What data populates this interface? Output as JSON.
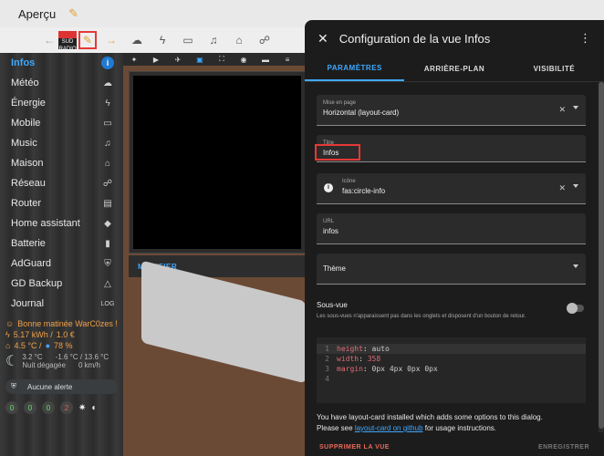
{
  "header": {
    "title": "Aperçu"
  },
  "toolbar": {
    "sud_badge": "SUD RADIO"
  },
  "sidebar": {
    "items": [
      {
        "label": "Infos",
        "icon": "info-icon"
      },
      {
        "label": "Météo",
        "icon": "weather-icon"
      },
      {
        "label": "Énergie",
        "icon": "bolt-icon"
      },
      {
        "label": "Mobile",
        "icon": "devices-icon"
      },
      {
        "label": "Music",
        "icon": "music-icon"
      },
      {
        "label": "Maison",
        "icon": "home-icon"
      },
      {
        "label": "Réseau",
        "icon": "network-icon"
      },
      {
        "label": "Router",
        "icon": "router-icon"
      },
      {
        "label": "Home assistant",
        "icon": "ha-icon"
      },
      {
        "label": "Batterie",
        "icon": "battery-icon"
      },
      {
        "label": "AdGuard",
        "icon": "shield-icon"
      },
      {
        "label": "GD Backup",
        "icon": "drive-icon"
      },
      {
        "label": "Journal",
        "icon": "log-icon"
      }
    ],
    "status": {
      "greeting": "Bonne matinée WarC0zes !",
      "energy": "5.17 kWh /",
      "cost": "1.0 €",
      "temp_out": "4.5 °C /",
      "humidity": "78 %",
      "temp_a": "3.2 °C",
      "temp_range": "-1.6 °C / 13.6 °C",
      "sky": "Nuit dégagée",
      "wind": "0 km/h",
      "alert": "Aucune alerte",
      "badges": [
        "0",
        "0",
        "0",
        "2"
      ]
    }
  },
  "card": {
    "footer": "MODIFIER"
  },
  "dialog": {
    "title": "Configuration de la vue Infos",
    "tabs": [
      "PARAMÈTRES",
      "ARRIÈRE-PLAN",
      "VISIBILITÉ"
    ],
    "fields": {
      "layout": {
        "label": "Mise en page",
        "value": "Horizontal (layout-card)"
      },
      "title": {
        "label": "Titre",
        "value": "Infos"
      },
      "icon": {
        "label": "Icône",
        "value": "fas:circle-info"
      },
      "url": {
        "label": "URL",
        "value": "infos"
      },
      "theme": {
        "label": "Thème"
      }
    },
    "subview": {
      "title": "Sous-vue",
      "desc": "Les sous-vues n'apparaissent pas dans les onglets et disposent d'un bouton de retour."
    },
    "code": [
      {
        "n": "1",
        "k": "height",
        "v": "auto"
      },
      {
        "n": "2",
        "k": "width",
        "v": "358"
      },
      {
        "n": "3",
        "k": "margin",
        "v": "0px 4px 0px 0px"
      },
      {
        "n": "4",
        "k": "",
        "v": ""
      }
    ],
    "note": {
      "line1": "You have layout-card installed which adds some options to this dialog.",
      "pre": "Please see ",
      "link": "layout-card on github",
      "post": " for usage instructions."
    },
    "footer": {
      "delete": "SUPPRIMER LA VUE",
      "save": "ENREGISTRER"
    }
  }
}
